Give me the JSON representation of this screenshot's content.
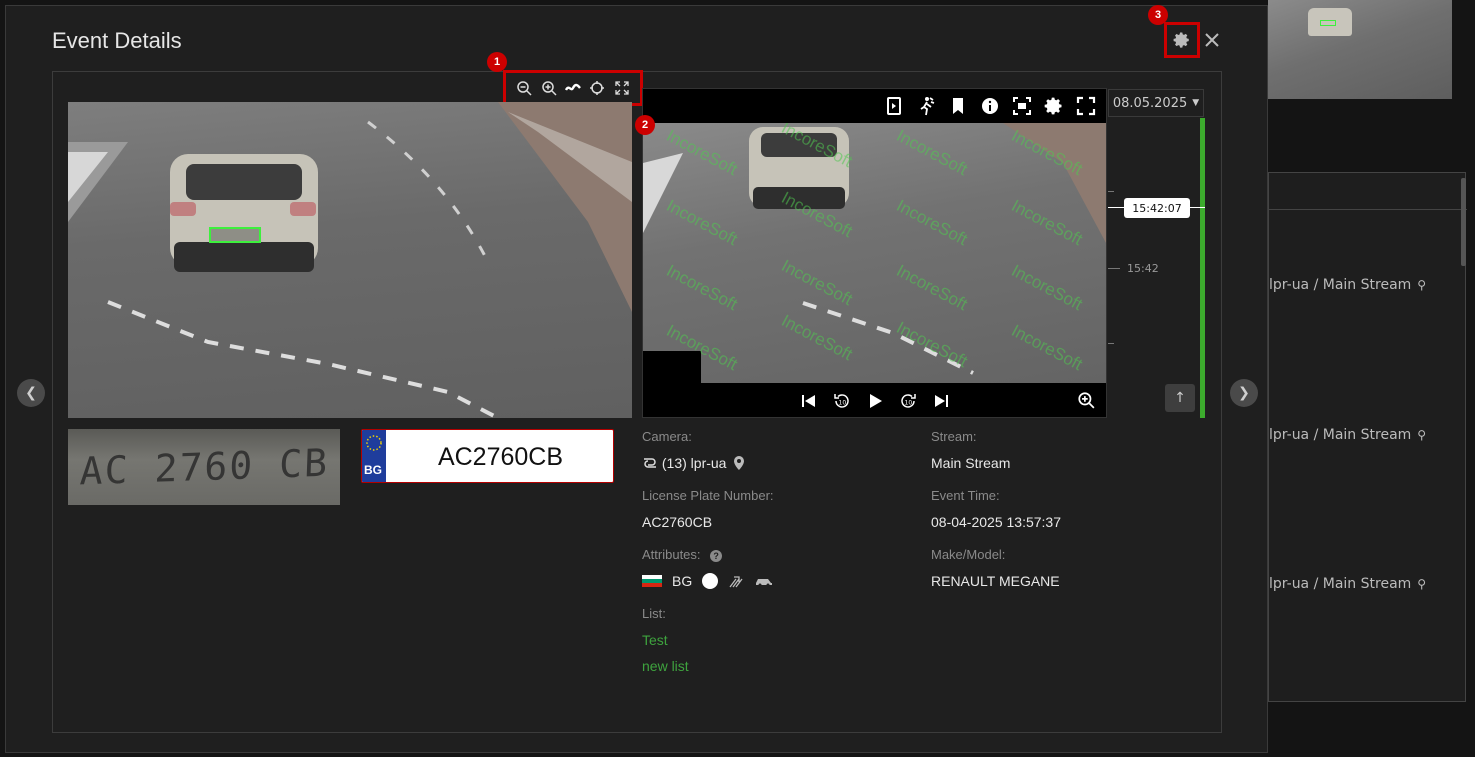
{
  "background": {
    "rows": [
      {
        "text": "lpr-ua / Main Stream"
      },
      {
        "text": "lpr-ua / Main Stream"
      },
      {
        "text": "lpr-ua / Main Stream"
      }
    ]
  },
  "modal": {
    "title": "Event Details",
    "close_icon": "close-icon",
    "settings_icon": "gear-icon",
    "badges": [
      "1",
      "2",
      "3"
    ]
  },
  "image_toolbar": {
    "icons": [
      "zoom-out-icon",
      "zoom-in-icon",
      "wave-icon",
      "crosshair-icon",
      "expand-icon"
    ]
  },
  "plate": {
    "country": "BG",
    "number": "AC2760CB",
    "crop_text": "AC 2760 CB"
  },
  "player": {
    "toolbar_icons": [
      "export-icon",
      "person-motion-icon",
      "bookmark-icon",
      "info-icon",
      "fit-icon",
      "settings-icon",
      "fullscreen-icon"
    ],
    "watermark": "IncoreSoft",
    "controls": [
      "skip-back-icon",
      "rewind-10-icon",
      "play-icon",
      "forward-10-icon",
      "skip-forward-icon"
    ],
    "zoom_icon": "zoom-in-icon"
  },
  "timeline": {
    "date": "08.05.2025",
    "current_time": "15:42:07",
    "tick_label": "15:42"
  },
  "details": {
    "camera_label": "Camera:",
    "camera_value": "(13) lpr-ua",
    "stream_label": "Stream:",
    "stream_value": "Main Stream",
    "lpn_label": "License Plate Number:",
    "lpn_value": "AC2760CB",
    "event_time_label": "Event Time:",
    "event_time_value": "08-04-2025 13:57:37",
    "attributes_label": "Attributes:",
    "attributes_country": "BG",
    "make_model_label": "Make/Model:",
    "make_model_value": "RENAULT MEGANE",
    "list_label": "List:",
    "lists": [
      "Test",
      "new list"
    ]
  },
  "colors": {
    "accent_green": "#3cab2d",
    "highlight_red": "#cc0000",
    "plate_blue": "#1f3d9c"
  }
}
